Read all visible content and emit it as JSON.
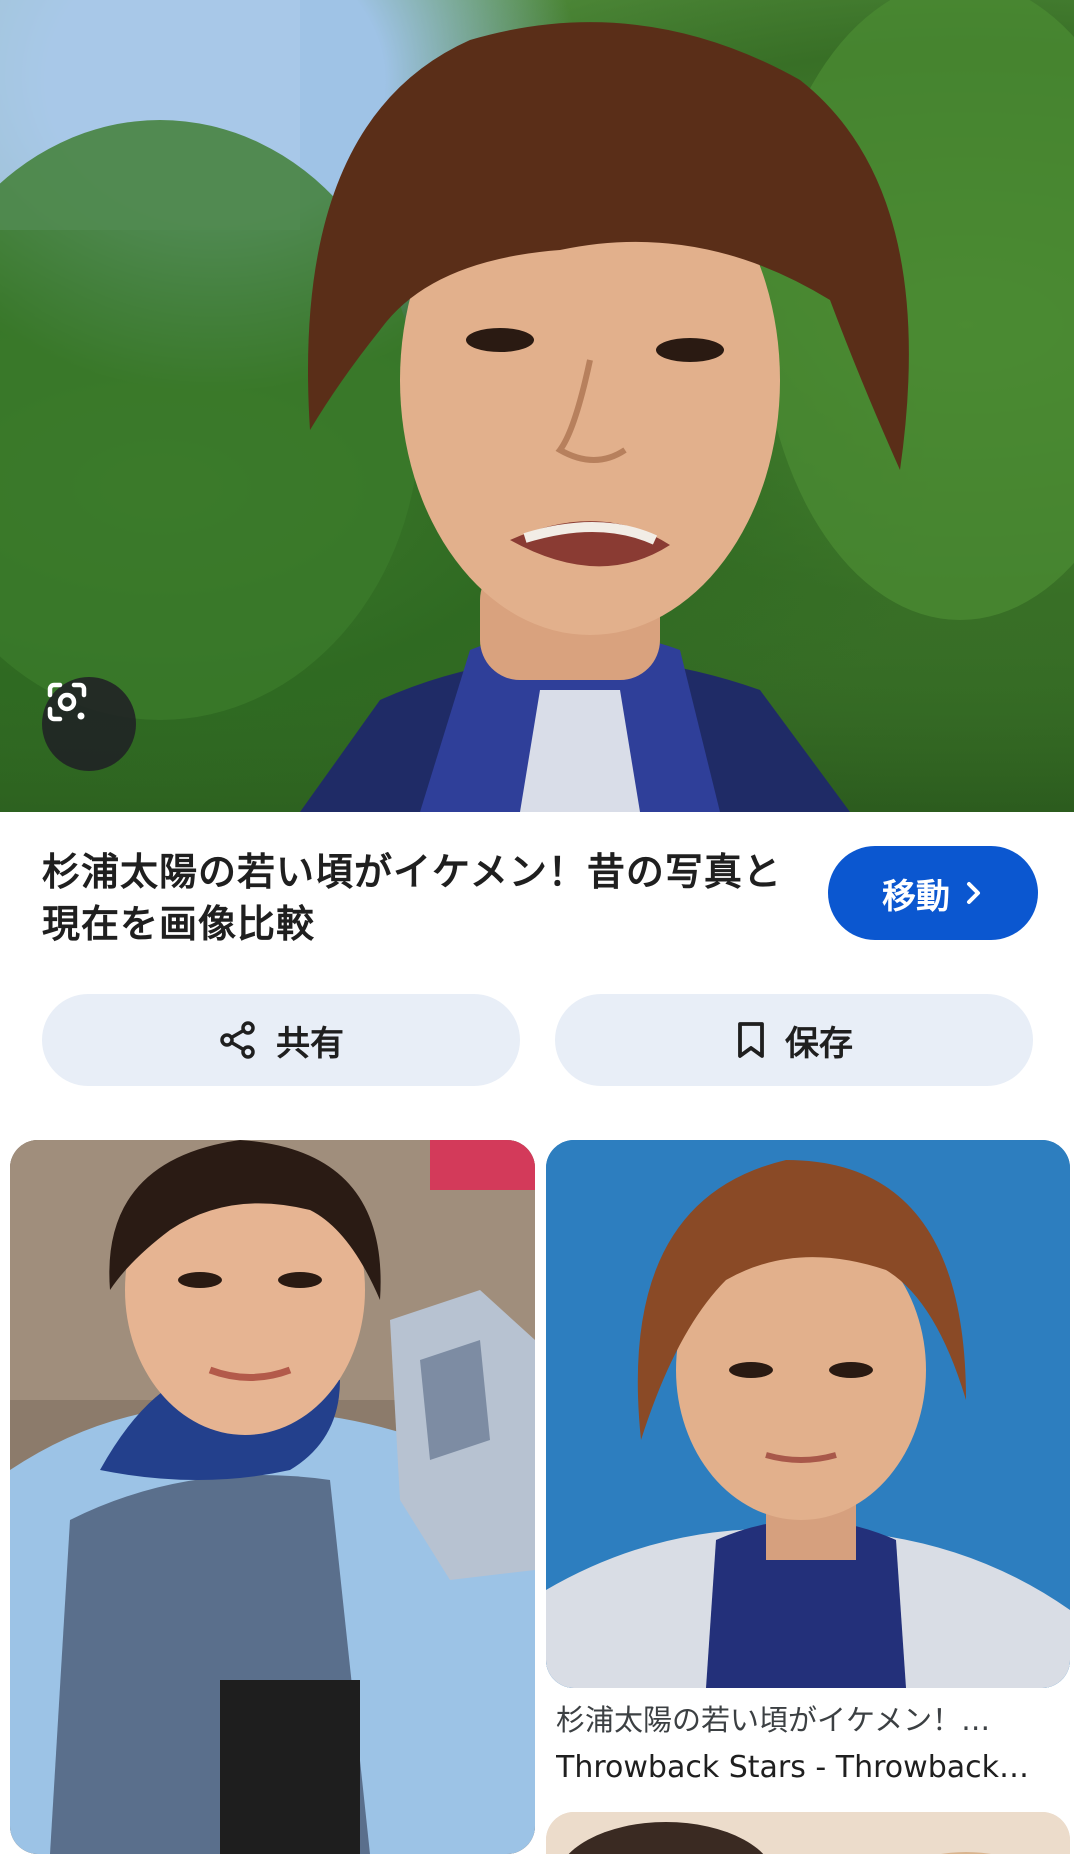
{
  "result": {
    "title": "杉浦太陽の若い頃がイケメン！昔の写真と現在を画像比較",
    "visit_label": "移動",
    "share_label": "共有",
    "save_label": "保存"
  },
  "icons": {
    "lens": "google-lens-icon",
    "chevron": "chevron-right-icon",
    "share": "share-icon",
    "bookmark": "bookmark-icon"
  },
  "related": [
    {
      "caption": "",
      "source": ""
    },
    {
      "caption": "杉浦太陽の若い頃がイケメン！…",
      "source": "Throwback Stars - Throwback…"
    }
  ],
  "colors": {
    "accent": "#0b57d0",
    "pill_bg": "#e8eef7"
  }
}
